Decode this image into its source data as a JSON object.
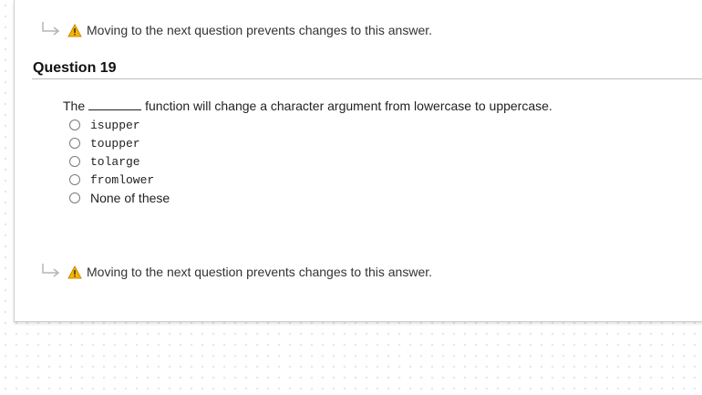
{
  "top_warning": {
    "text": "Moving to the next question prevents changes to this answer."
  },
  "question": {
    "title": "Question 19",
    "text_before": "The",
    "text_after": "function will change a character argument from lowercase to uppercase.",
    "options": [
      {
        "label": "isupper",
        "style": "code",
        "selected": false
      },
      {
        "label": "toupper",
        "style": "code",
        "selected": false
      },
      {
        "label": "tolarge",
        "style": "code",
        "selected": false
      },
      {
        "label": "fromlower",
        "style": "code",
        "selected": false
      },
      {
        "label": "None of these",
        "style": "plain",
        "selected": false
      }
    ]
  },
  "bottom_warning": {
    "text": "Moving to the next question prevents changes to this answer."
  },
  "colors": {
    "warning_yellow": "#f5b400",
    "warning_stroke": "#c98b00",
    "arrow_gray": "#b5b5b5"
  }
}
